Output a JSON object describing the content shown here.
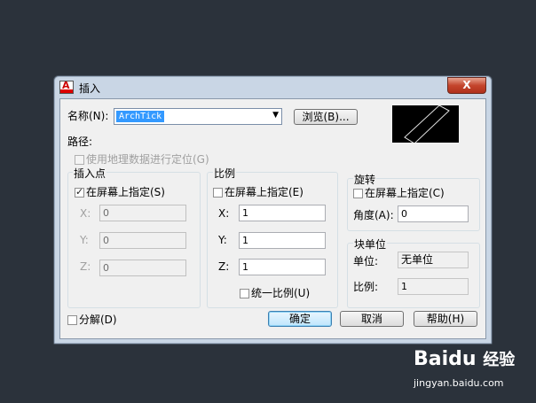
{
  "dialog": {
    "title": "插入",
    "close_label": "X",
    "name_label": "名称(N):",
    "name_value": "ArchTick",
    "browse_label": "浏览(B)...",
    "path_label": "路径:",
    "geo_label": "使用地理数据进行定位(G)"
  },
  "insertion": {
    "title": "插入点",
    "specify_label": "在屏幕上指定(S)",
    "specify_checked": true,
    "x_label": "X:",
    "x_value": "0",
    "y_label": "Y:",
    "y_value": "0",
    "z_label": "Z:",
    "z_value": "0"
  },
  "scale": {
    "title": "比例",
    "specify_label": "在屏幕上指定(E)",
    "x_label": "X:",
    "x_value": "1",
    "y_label": "Y:",
    "y_value": "1",
    "z_label": "Z:",
    "z_value": "1",
    "uniform_label": "统一比例(U)"
  },
  "rotation": {
    "title": "旋转",
    "specify_label": "在屏幕上指定(C)",
    "angle_label": "角度(A):",
    "angle_value": "0"
  },
  "block_unit": {
    "title": "块单位",
    "unit_label": "单位:",
    "unit_value": "无单位",
    "factor_label": "比例:",
    "factor_value": "1"
  },
  "explode_label": "分解(D)",
  "buttons": {
    "ok": "确定",
    "cancel": "取消",
    "help": "帮助(H)"
  },
  "watermark": {
    "brand": "Baidu",
    "cn": "经验",
    "url": "jingyan.baidu.com"
  }
}
